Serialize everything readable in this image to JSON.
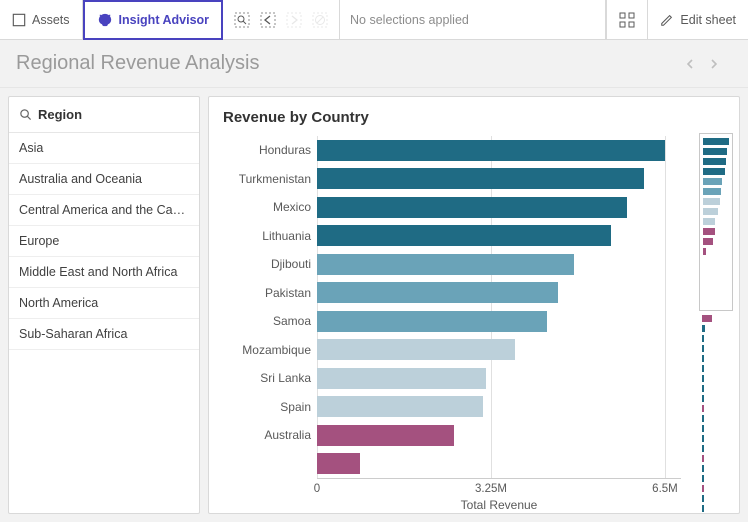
{
  "toolbar": {
    "assets_label": "Assets",
    "insight_label": "Insight Advisor",
    "no_selections": "No selections applied",
    "edit_label": "Edit sheet"
  },
  "page": {
    "title": "Regional Revenue Analysis"
  },
  "filter": {
    "header": "Region",
    "items": [
      "Asia",
      "Australia and Oceania",
      "Central America and the Carib…",
      "Europe",
      "Middle East and North Africa",
      "North America",
      "Sub-Saharan Africa"
    ]
  },
  "chart": {
    "title": "Revenue by Country",
    "xlabel": "Total Revenue",
    "ticks": {
      "t0": "0",
      "t1": "3.25M",
      "t2": "6.5M"
    }
  },
  "chart_data": {
    "type": "bar",
    "orientation": "horizontal",
    "title": "Revenue by Country",
    "xlabel": "Total Revenue",
    "ylabel": "",
    "xlim": [
      0,
      6800000
    ],
    "x_ticks": [
      0,
      3250000,
      6500000
    ],
    "categories": [
      "Honduras",
      "Turkmenistan",
      "Mexico",
      "Lithuania",
      "Djibouti",
      "Pakistan",
      "Samoa",
      "Mozambique",
      "Sri Lanka",
      "Spain",
      "Australia",
      ""
    ],
    "values": [
      6500000,
      6100000,
      5800000,
      5500000,
      4800000,
      4500000,
      4300000,
      3700000,
      3150000,
      3100000,
      2550000,
      800000
    ],
    "color_group": [
      "dark",
      "dark",
      "dark",
      "dark",
      "mid",
      "mid",
      "mid",
      "light",
      "light",
      "light",
      "purple",
      "purple"
    ],
    "minimap": {
      "inside": [
        {
          "v": 1.0,
          "c": "dark"
        },
        {
          "v": 0.94,
          "c": "dark"
        },
        {
          "v": 0.89,
          "c": "dark"
        },
        {
          "v": 0.85,
          "c": "dark"
        },
        {
          "v": 0.74,
          "c": "mid"
        },
        {
          "v": 0.69,
          "c": "mid"
        },
        {
          "v": 0.66,
          "c": "light"
        },
        {
          "v": 0.57,
          "c": "light"
        },
        {
          "v": 0.48,
          "c": "light"
        },
        {
          "v": 0.48,
          "c": "purple"
        },
        {
          "v": 0.39,
          "c": "purple"
        },
        {
          "v": 0.12,
          "c": "purple"
        }
      ],
      "outside": [
        {
          "v": 0.34,
          "c": "purple"
        },
        {
          "v": 0.12,
          "c": "dark"
        },
        {
          "v": 0.07,
          "c": "dark"
        },
        {
          "v": 0.07,
          "c": "dark"
        },
        {
          "v": 0.07,
          "c": "dark"
        },
        {
          "v": 0.07,
          "c": "dark"
        },
        {
          "v": 0.07,
          "c": "dark"
        },
        {
          "v": 0.07,
          "c": "dark"
        },
        {
          "v": 0.07,
          "c": "dark"
        },
        {
          "v": 0.07,
          "c": "purple"
        },
        {
          "v": 0.07,
          "c": "dark"
        },
        {
          "v": 0.07,
          "c": "dark"
        },
        {
          "v": 0.07,
          "c": "dark"
        },
        {
          "v": 0.07,
          "c": "dark"
        },
        {
          "v": 0.07,
          "c": "purple"
        },
        {
          "v": 0.07,
          "c": "dark"
        },
        {
          "v": 0.07,
          "c": "dark"
        },
        {
          "v": 0.07,
          "c": "purple"
        },
        {
          "v": 0.07,
          "c": "dark"
        },
        {
          "v": 0.07,
          "c": "dark"
        }
      ]
    }
  }
}
